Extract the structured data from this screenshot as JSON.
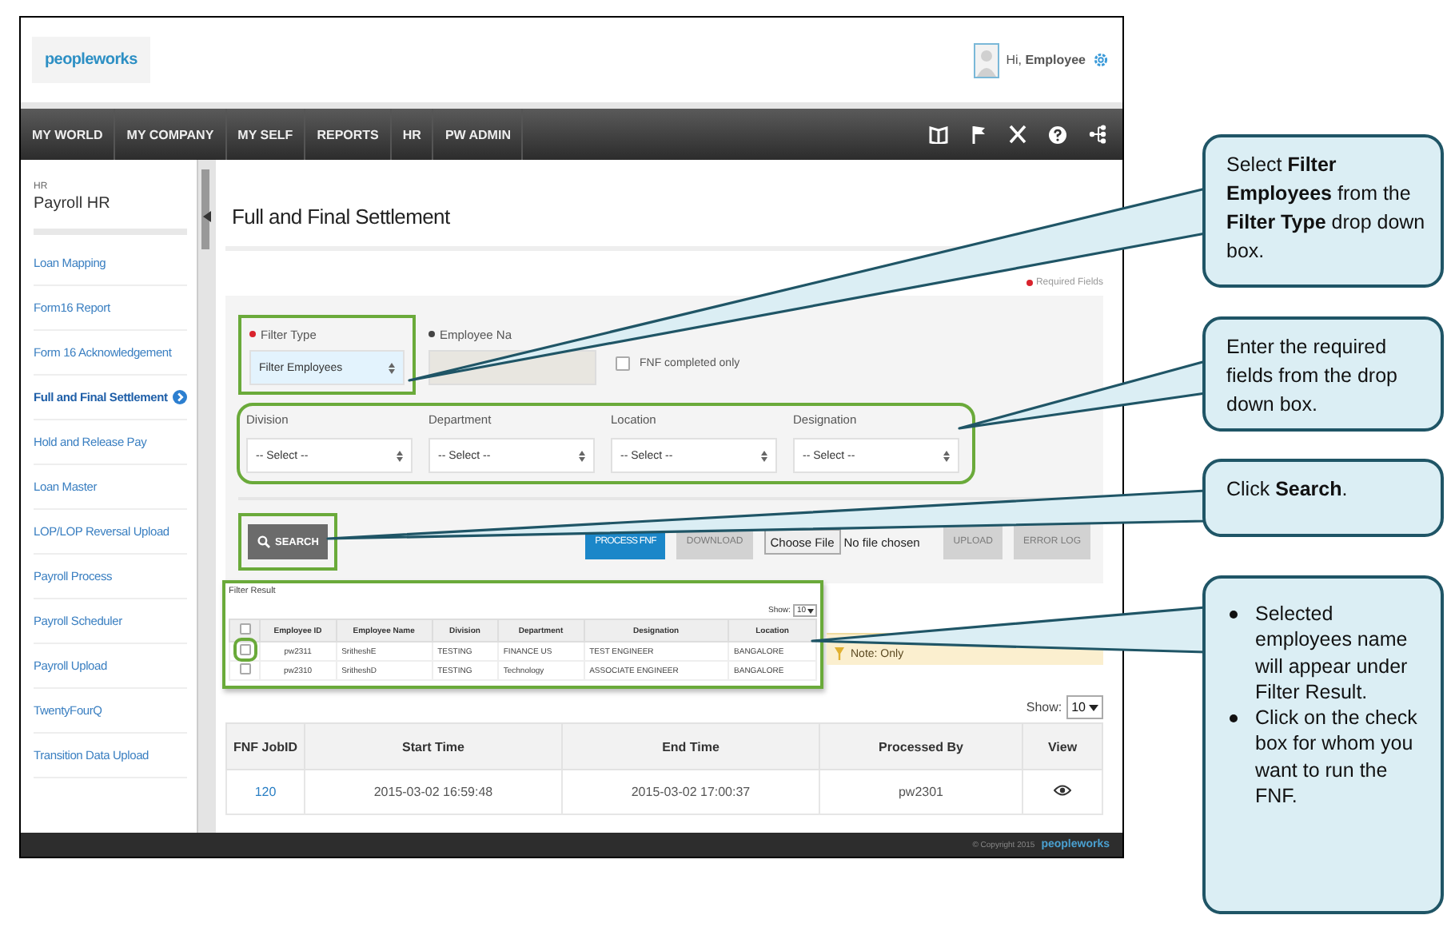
{
  "header": {
    "logo": "peopleworks",
    "greeting": "Hi, **Employee**"
  },
  "nav": [
    "MY WORLD",
    "MY COMPANY",
    "MY SELF",
    "REPORTS",
    "HR",
    "PW ADMIN"
  ],
  "sidebar": {
    "section": "HR",
    "title": "Payroll HR",
    "items": [
      {
        "label": "Loan Mapping",
        "selected": false
      },
      {
        "label": "Form16 Report",
        "selected": false
      },
      {
        "label": "Form 16 Acknowledgement",
        "selected": false
      },
      {
        "label": "Full and Final Settlement",
        "selected": true
      },
      {
        "label": "Hold and Release Pay",
        "selected": false
      },
      {
        "label": "Loan Master",
        "selected": false
      },
      {
        "label": "LOP/LOP Reversal Upload",
        "selected": false
      },
      {
        "label": "Payroll Process",
        "selected": false
      },
      {
        "label": "Payroll Scheduler",
        "selected": false
      },
      {
        "label": "Payroll Upload",
        "selected": false
      },
      {
        "label": "TwentyFourQ",
        "selected": false
      },
      {
        "label": "Transition Data Upload",
        "selected": false
      }
    ]
  },
  "page": {
    "title": "Full and Final Settlement",
    "required_note": "Required Fields"
  },
  "filter": {
    "filter_type": {
      "label": "Filter Type",
      "value": "Filter Employees"
    },
    "employee_name": {
      "label": "Employee Na"
    },
    "fnf_completed": {
      "label": "FNF completed only",
      "checked": false
    },
    "selects": [
      {
        "label": "Division",
        "value": "-- Select --"
      },
      {
        "label": "Department",
        "value": "-- Select --"
      },
      {
        "label": "Location",
        "value": "-- Select --"
      },
      {
        "label": "Designation",
        "value": "-- Select --"
      }
    ]
  },
  "actions": {
    "search": "SEARCH",
    "buttons": [
      {
        "kind": "primary",
        "label": "PROCESS FNF",
        "disabled": false
      },
      {
        "kind": "action",
        "label": "DOWNLOAD",
        "disabled": true
      },
      {
        "kind": "file",
        "label": "Choose File",
        "status": "No file chosen"
      },
      {
        "kind": "action",
        "label": "UPLOAD",
        "disabled": true
      },
      {
        "kind": "action",
        "label": "ERROR LOG",
        "disabled": true
      }
    ]
  },
  "filter_result": {
    "title": "Filter Result",
    "show_label": "Show:",
    "show_value": "10",
    "all_checked": false,
    "columns": [
      "Employee ID",
      "Employee Name",
      "Division",
      "Department",
      "Designation",
      "Location"
    ],
    "rows": [
      {
        "checked": false,
        "cells": [
          "pw2311",
          "SritheshE",
          "TESTING",
          "FINANCE US",
          "TEST ENGINEER",
          "BANGALORE"
        ]
      },
      {
        "checked": false,
        "cells": [
          "pw2310",
          "SritheshD",
          "TESTING",
          "Technology",
          "ASSOCIATE ENGINEER",
          "BANGALORE"
        ]
      }
    ]
  },
  "note": "Note: Only",
  "jobs": {
    "show_label": "Show:",
    "show_value": "10",
    "columns": [
      "FNF JobID",
      "Start Time",
      "End Time",
      "Processed By",
      "View"
    ],
    "rows": [
      {
        "cells": [
          "120",
          "2015-03-02 16:59:48",
          "2015-03-02 17:00:37",
          "pw2301"
        ]
      }
    ]
  },
  "footer": {
    "copyright": "© Copyright 2015",
    "logo": "peopleworks"
  },
  "callouts": [
    {
      "kind": "text",
      "text": "Select **Filter Employees** from the **Filter Type** drop down box."
    },
    {
      "kind": "text",
      "text": "Enter the required fields from the drop down box."
    },
    {
      "kind": "text",
      "text": "Click **Search**."
    },
    {
      "kind": "bullets",
      "items": [
        "Selected employees name will appear under Filter Result.",
        "Click on the check box for whom you want to run the FNF."
      ]
    }
  ]
}
